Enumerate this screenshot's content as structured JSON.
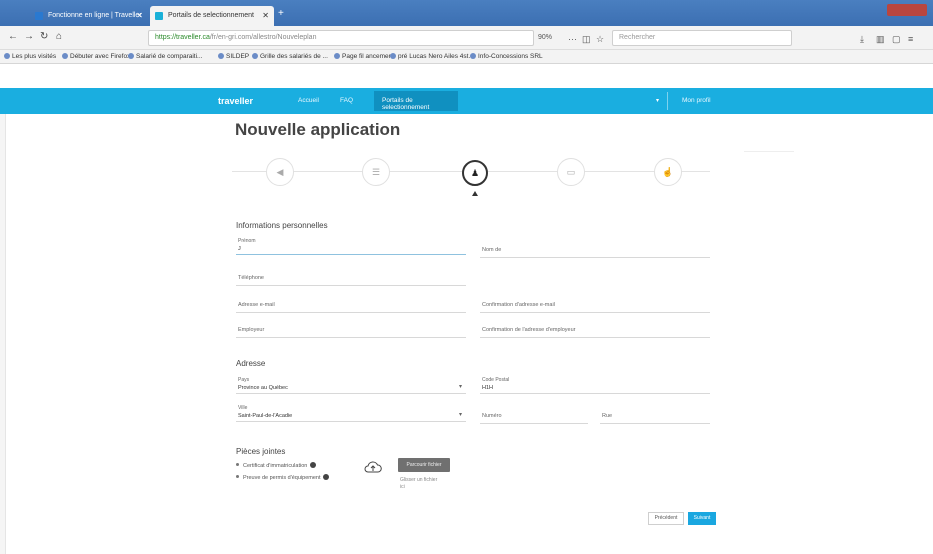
{
  "browser": {
    "tabs": [
      {
        "label": "Fonctionne en ligne | Traveller"
      },
      {
        "label": "Portails de selectionnement"
      }
    ],
    "url_host": "https://traveller.ca",
    "url_rest": "/fr/en-gri.com/allestro/Nouveleplan",
    "zoom": "90%",
    "search_placeholder": "Rechercher",
    "nav_icons": {
      "back": "←",
      "forward": "→",
      "reload": "↻",
      "home": "⌂"
    },
    "bookmarks": [
      "Les plus visités",
      "Débuter avec Firefox",
      "Salarié de comparaiti...",
      "SILDEP",
      "Grille des salariés de ...",
      "Page fil ancement",
      "pré Lucas Nero Ailes 4st...",
      "Info-Concessions SRL"
    ]
  },
  "app": {
    "logo": "traveller",
    "nav": [
      "Accueil",
      "FAQ"
    ],
    "nav_active": "Portails de selectionnement",
    "user": "Mon profil",
    "brand_color": "#1aaee0"
  },
  "page": {
    "title": "Nouvelle application",
    "steps": [
      {
        "icon": "megaphone-icon",
        "glyph": "◀"
      },
      {
        "icon": "list-icon",
        "glyph": "☰"
      },
      {
        "icon": "person-icon",
        "glyph": "♟"
      },
      {
        "icon": "calendar-icon",
        "glyph": "▭"
      },
      {
        "icon": "thumbs-up-icon",
        "glyph": "☝"
      }
    ],
    "active_step": 3,
    "section_personal": "Informations personnelles",
    "fields": {
      "prenom_label": "Prénom",
      "prenom_value": "J",
      "nom_label": "Nom de",
      "telephone_label": "Téléphone",
      "courriel_label": "Adresse e-mail",
      "courriel_confirm_label": "Confirmation d'adresse e-mail",
      "employeur_label": "Employeur",
      "employeur_confirm_label": "Confirmation de l'adresse d'employeur"
    },
    "section_address": "Adresse",
    "address": {
      "province_label": "Pays",
      "province_value": "Province au Québec",
      "code_postal_label": "Code Postal",
      "code_postal_value": "H1H",
      "ville_label": "Ville",
      "ville_value": "Saint-Paul-de-l'Acadie",
      "numero_label": "Numéro",
      "rue_label": "Rue"
    },
    "section_attachments": "Pièces jointes",
    "attachments": [
      "Certificat d'immatriculation",
      "Preuve de permis d'équipement"
    ],
    "upload_button": "Parcourir fichier",
    "upload_hint": "Glisser un fichier ici",
    "btn_prev": "Précédent",
    "btn_next": "Suivant"
  }
}
